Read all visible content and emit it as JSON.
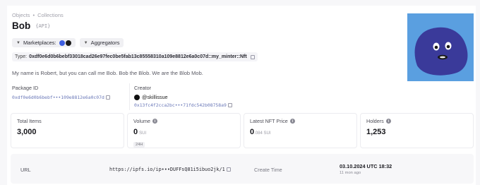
{
  "breadcrumb": {
    "root": "Objects",
    "sep": "•",
    "current": "Collections"
  },
  "collection": {
    "name": "Bob",
    "badge": "{API}",
    "description": "My name is Robert, but you can call me Bob. Bob the Blob. We are the Blob Mob.",
    "type_label": "Type:",
    "type_value": "0xdf0e6d0b6bebf33018cad26e97fec0be5fab13c85558310a109e8812e6a0c07d::my_minter::Nft"
  },
  "filters": {
    "marketplaces_label": "Marketplaces:",
    "aggregators_label": "Aggregators",
    "marketplace_icon_colors": [
      "#3d5ee0",
      "#1a1a1a"
    ]
  },
  "package": {
    "label": "Package ID",
    "value": "0xdf0e6d0b6bebf•••109e8812e6a0c07d"
  },
  "creator": {
    "label": "Creator",
    "name": "@skillissue",
    "address": "0x13fc4f2cca2bc•••71fdc542b08758a9"
  },
  "stats": [
    {
      "label": "Total Items",
      "value": "3,000",
      "unit": "",
      "sub": "",
      "info": false
    },
    {
      "label": "Volume",
      "value": "0",
      "unit": "SUI",
      "sub": "24H",
      "info": true
    },
    {
      "label": "Latest NFT Price",
      "value": "0",
      "unit": ".084 SUI",
      "sub": "",
      "info": true
    },
    {
      "label": "Holders",
      "value": "1,253",
      "unit": "",
      "sub": "",
      "info": true
    }
  ],
  "details": {
    "url_label": "URL",
    "url_value": "https://ipfs.io/ip•••DUFFsQ81i5ibuo2jk/1",
    "create_time_label": "Create Time",
    "create_time_value": "03.10.2024 UTC 18:32",
    "create_time_ago": "11 mon ago"
  },
  "colors": {
    "accent_link": "#6a78b8",
    "hero_bg": "#5a9fe0",
    "blob": "#3a3a9a"
  }
}
